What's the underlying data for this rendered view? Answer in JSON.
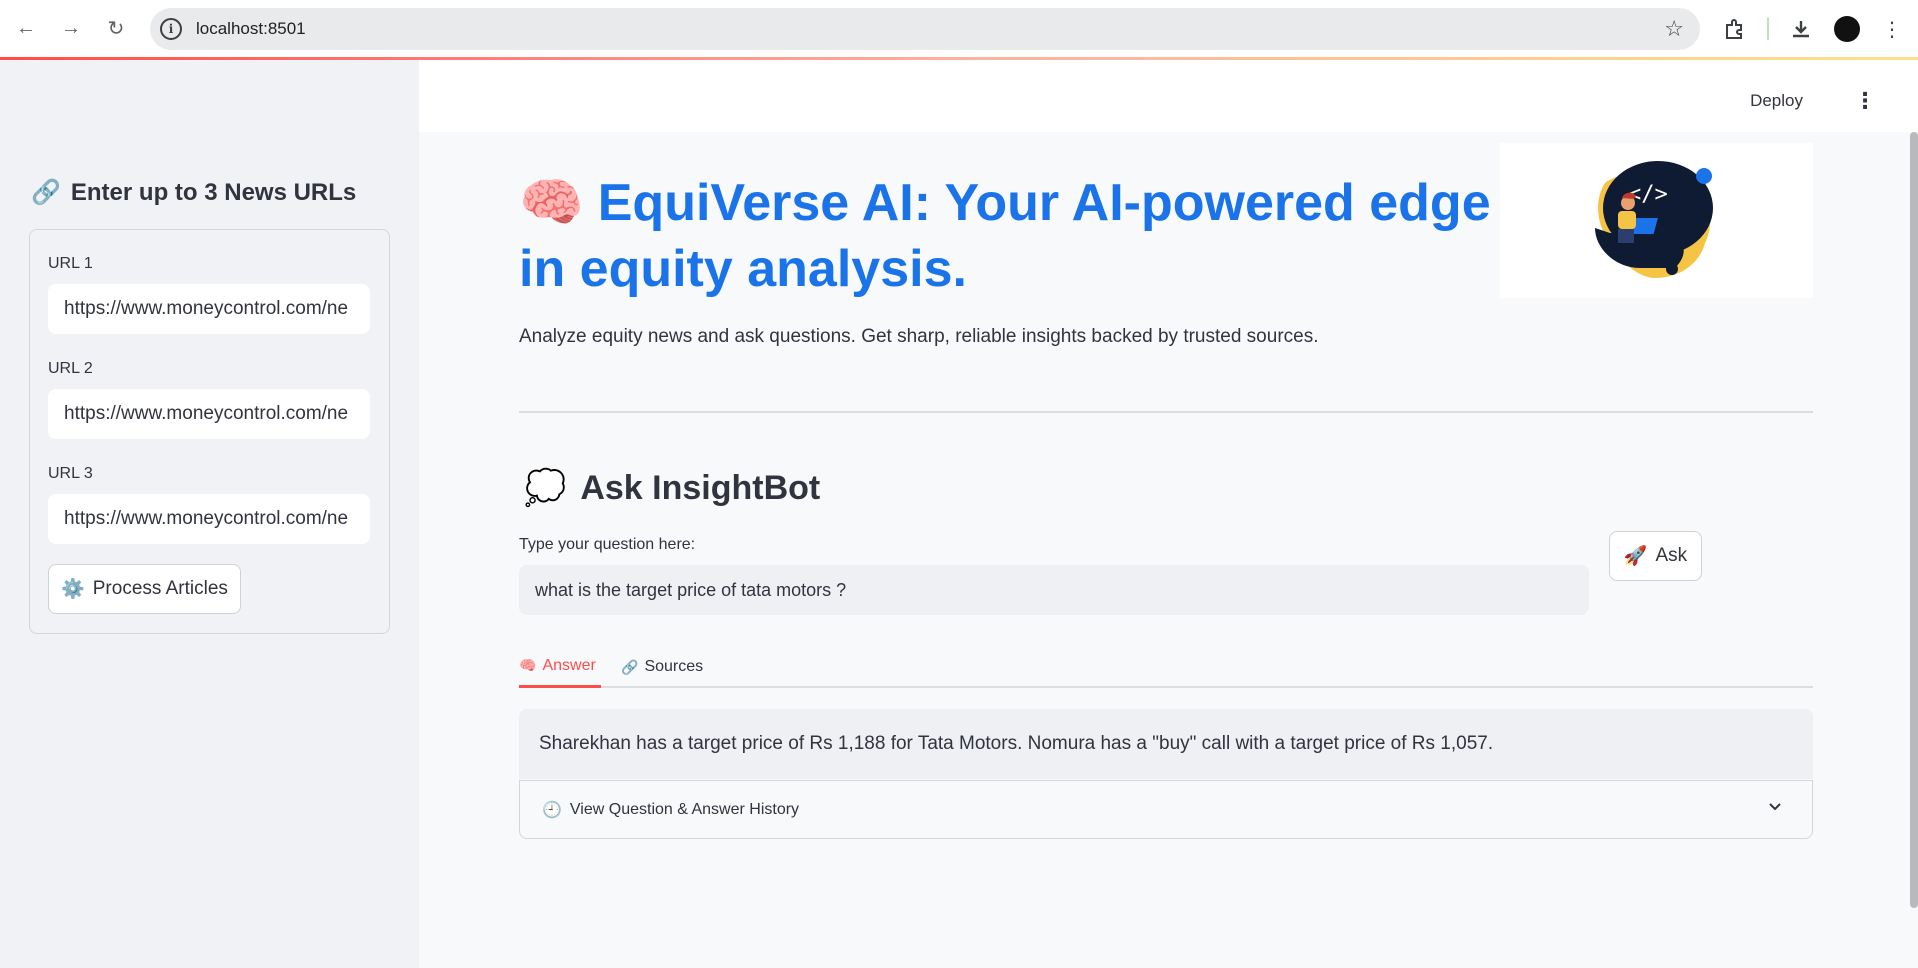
{
  "browser": {
    "address": "localhost:8501"
  },
  "sidebar": {
    "title": "Enter up to 3 News URLs",
    "title_icon": "link-icon",
    "urls": [
      {
        "label": "URL 1",
        "value": "https://www.moneycontrol.com/ne"
      },
      {
        "label": "URL 2",
        "value": "https://www.moneycontrol.com/ne"
      },
      {
        "label": "URL 3",
        "value": "https://www.moneycontrol.com/ne"
      }
    ],
    "process_button": "Process Articles",
    "process_icon": "gear-icon"
  },
  "header": {
    "deploy": "Deploy",
    "menu_icon": "kebab-menu-icon"
  },
  "hero": {
    "title": "EquiVerse AI: Your AI-powered edge in equity analysis.",
    "title_icon": "brain-icon",
    "subtitle": "Analyze equity news and ask questions. Get sharp, reliable insights backed by trusted sources."
  },
  "ask": {
    "title": "Ask InsightBot",
    "title_icon": "speech-bubble-icon",
    "question_label": "Type your question here:",
    "question_value": "what is the target price of tata motors ?",
    "ask_button": "Ask",
    "ask_icon": "rocket-icon"
  },
  "tabs": [
    {
      "label": "Answer",
      "icon": "brain-icon",
      "active": true
    },
    {
      "label": "Sources",
      "icon": "link-icon",
      "active": false
    }
  ],
  "answer": "Sharekhan has a target price of Rs 1,188 for Tata Motors. Nomura has a \"buy\" call with a target price of Rs 1,057.",
  "history": {
    "label": "View Question & Answer History",
    "icon": "clock-icon"
  },
  "colors": {
    "accent": "#ff4b4b",
    "title_blue": "#1a73e8",
    "sidebar_bg": "#f0f2f6"
  }
}
